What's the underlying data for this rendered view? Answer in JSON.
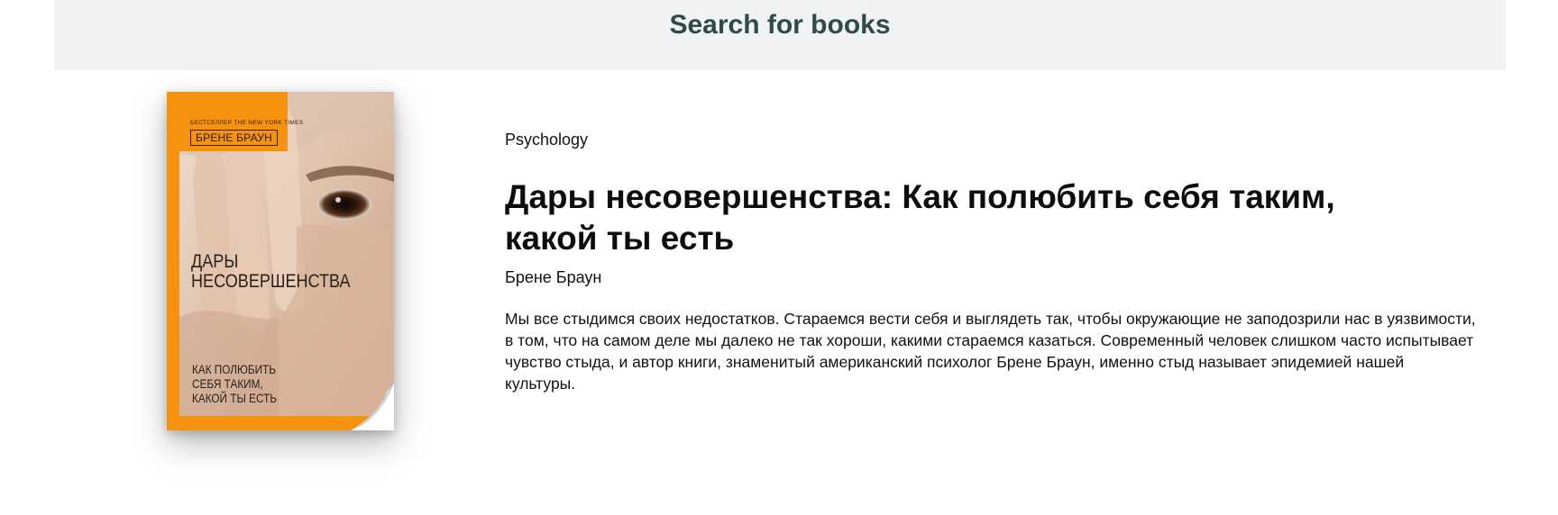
{
  "header": {
    "title": "Search for books"
  },
  "book": {
    "category": "Psychology",
    "title": "Дары несовершенства: Как полюбить себя таким, какой ты есть",
    "author": "Брене Браун",
    "description": "Мы все стыдимся своих недостатков. Стараемся вести себя и выглядеть так, чтобы окружающие не заподозрили нас в уязвимости, в том, что на самом деле мы далеко не так хороши, какими стараемся казаться. Современный человек слишком часто испытывает чувство стыда, и автор книги, знаменитый американский психолог Брене Браун, именно стыд называет эпидемией нашей культуры.",
    "cover": {
      "series_text": "БЕСТСЕЛЛЕР THE NEW YORK TIMES",
      "author_text": "БРЕНЕ БРАУН",
      "title_line1": "ДАРЫ",
      "title_line2": "НЕСОВЕРШЕНСТВА",
      "subtitle_line1": "КАК ПОЛЮБИТЬ",
      "subtitle_line2": "СЕБЯ ТАКИМ,",
      "subtitle_line3": "КАКОЙ ТЫ ЕСТЬ",
      "accent_color": "#f5920f"
    }
  },
  "colors": {
    "header_bg": "#f1f2f3",
    "header_text": "#2e4a4a",
    "body_text": "#111111"
  }
}
